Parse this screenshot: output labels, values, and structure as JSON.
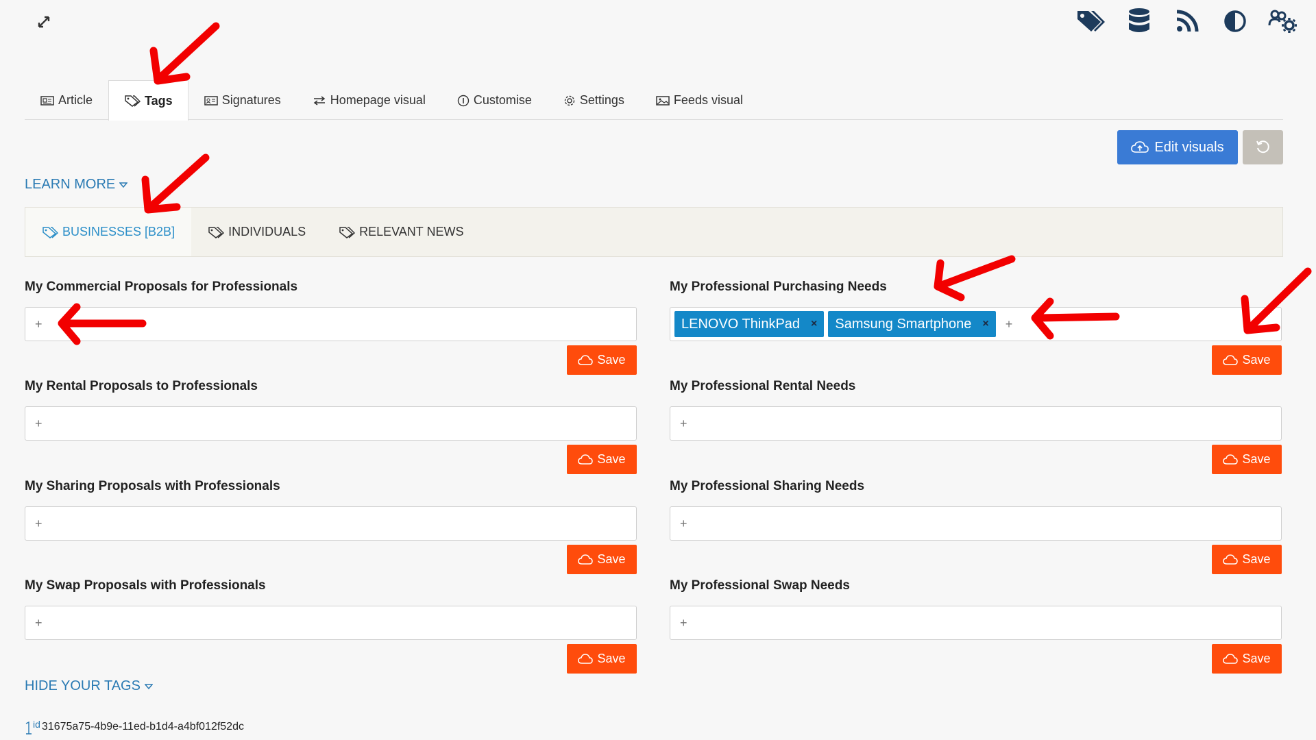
{
  "colors": {
    "accent_blue": "#3a7bd5",
    "link_blue": "#2a7ab3",
    "save_orange": "#ff4c0c",
    "chip_blue": "#1488c8",
    "annotation_red": "#f20000"
  },
  "toolbar_icons": [
    "tags-icon",
    "database-icon",
    "rss-icon",
    "contrast-icon",
    "users-settings-icon"
  ],
  "tabs": [
    {
      "label": "Article",
      "icon": "newspaper-icon"
    },
    {
      "label": "Tags",
      "icon": "tags-icon"
    },
    {
      "label": "Signatures",
      "icon": "id-card-icon"
    },
    {
      "label": "Homepage visual",
      "icon": "arrows-swap-icon"
    },
    {
      "label": "Customise",
      "icon": "info-circle-icon"
    },
    {
      "label": "Settings",
      "icon": "gear-icon"
    },
    {
      "label": "Feeds visual",
      "icon": "image-icon"
    }
  ],
  "actions": {
    "edit_visuals": "Edit visuals"
  },
  "learn_more": "LEARN MORE",
  "subtabs": [
    {
      "label": "BUSINESSES [B2B]"
    },
    {
      "label": "INDIVIDUALS"
    },
    {
      "label": "RELEVANT NEWS"
    }
  ],
  "fields": {
    "left": [
      {
        "label": "My Commercial Proposals for Professionals"
      },
      {
        "label": "My Rental Proposals to Professionals"
      },
      {
        "label": "My Sharing Proposals with Professionals"
      },
      {
        "label": "My Swap Proposals with Professionals"
      }
    ],
    "right": [
      {
        "label": "My Professional Purchasing Needs",
        "tags": [
          "LENOVO ThinkPad",
          "Samsung Smartphone"
        ]
      },
      {
        "label": "My Professional Rental Needs"
      },
      {
        "label": "My Professional Sharing Needs"
      },
      {
        "label": "My Professional Swap Needs"
      }
    ]
  },
  "save_label": "Save",
  "plus_sign": "+",
  "chip_remove": "×",
  "hide_tags": "HIDE YOUR TAGS",
  "id_label": "id",
  "id_value": "31675a75-4b9e-11ed-b1d4-a4bf012f52dc"
}
